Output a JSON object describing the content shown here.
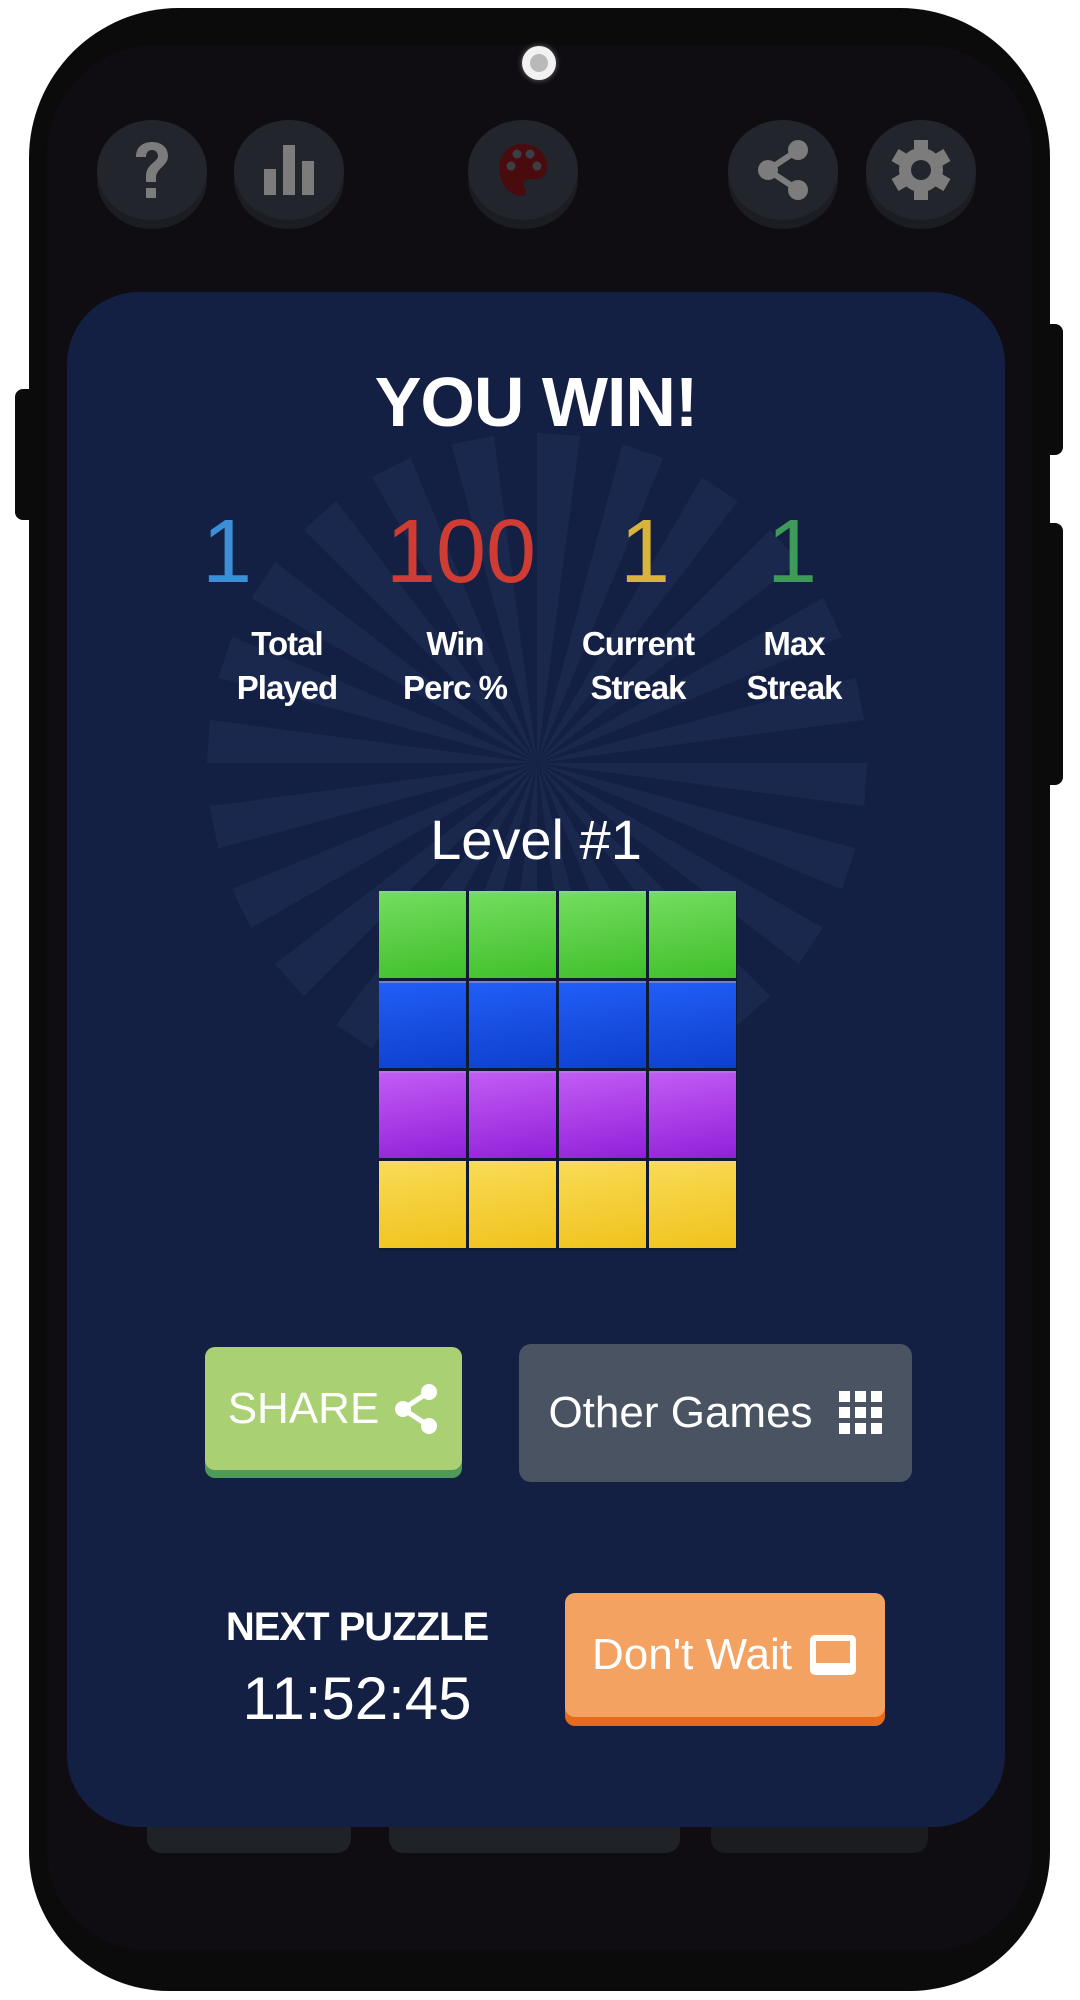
{
  "toolbar": {
    "help_icon": "question-mark",
    "stats_icon": "bar-chart",
    "theme_icon": "palette",
    "share_icon": "share",
    "settings_icon": "gear"
  },
  "result": {
    "title": "YOU WIN!",
    "stats": [
      {
        "value": "1",
        "label_line1": "Total",
        "label_line2": "Played",
        "color": "#3b8fd9"
      },
      {
        "value": "100",
        "label_line1": "Win",
        "label_line2": "Perc %",
        "color": "#cf3c33"
      },
      {
        "value": "1",
        "label_line1": "Current",
        "label_line2": "Streak",
        "color": "#d8b53a"
      },
      {
        "value": "1",
        "label_line1": "Max",
        "label_line2": "Streak",
        "color": "#3e9a58"
      }
    ],
    "level": "Level #1",
    "grid": {
      "rows": [
        {
          "color": "green",
          "top": "#74dd5e",
          "bottom": "#3fbf2b"
        },
        {
          "color": "blue",
          "top": "#215ef7",
          "bottom": "#0d3fcc"
        },
        {
          "color": "purple",
          "top": "#c25cf4",
          "bottom": "#9120d9"
        },
        {
          "color": "yellow",
          "top": "#f9db55",
          "bottom": "#f0c21c"
        }
      ],
      "columns": 4
    }
  },
  "actions": {
    "share_label": "SHARE",
    "other_games_label": "Other Games",
    "next_puzzle_label": "NEXT PUZZLE",
    "countdown": "11:52:45",
    "dont_wait_label": "Don't Wait"
  },
  "colors": {
    "card_bg": "#132043",
    "share_bg": "#a9d174",
    "other_bg": "#4a5361",
    "dont_wait_bg": "#f4a261"
  }
}
